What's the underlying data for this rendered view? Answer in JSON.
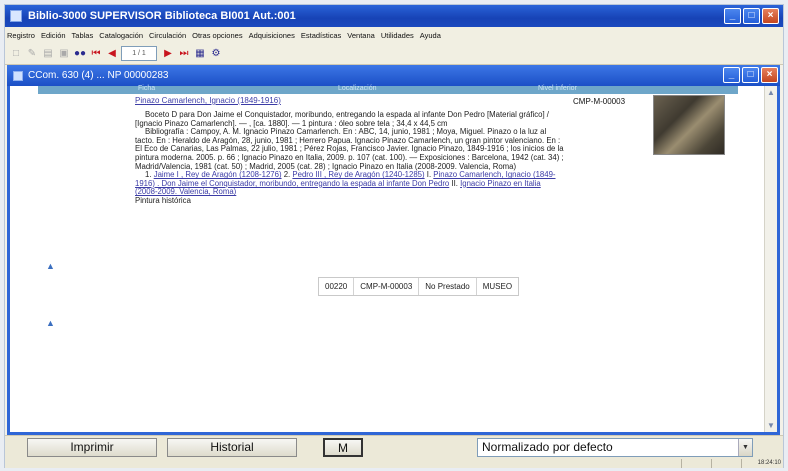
{
  "app": {
    "title": "Biblio-3000 SUPERVISOR  Biblioteca BI001 Aut.:001",
    "window_buttons": [
      "_",
      "□",
      "×"
    ]
  },
  "menu": {
    "items": [
      "Registro",
      "Edición",
      "Tablas",
      "Catalogación",
      "Circulación",
      "Otras opciones",
      "Adquisiciones",
      "Estadísticas",
      "Ventana",
      "Utilidades",
      "Ayuda"
    ]
  },
  "toolbar": {
    "record_field": "1 / 1"
  },
  "record_window": {
    "title": "CCom. 630 (4) ... NP 00000283",
    "headers": {
      "col1": "Ficha",
      "col2": "Localización",
      "col3": "Nivel inferior"
    },
    "author_link": "Pinazo Camarlench, Ignacio (1849-1916)",
    "signatura": "CMP-M-00003",
    "description": "Boceto D para Don Jaime el Conquistador, moribundo, entregando la espada al infante Don Pedro [Material gráfico] / [Ignacio Pinazo Camarlench]. — , [ca. 1880]. — 1 pintura : óleo sobre tela ; 34,4 x 44,5 cm",
    "bibliography": "Bibliografía : Campoy, A. M. Ignacio Pinazo Camarlench. En : ABC, 14, junio, 1981 ; Moya, Miguel. Pinazo o la luz al tacto. En : Heraldo de Aragón, 28, junio, 1981 ; Herrero Papua. Ignacio Pinazo Camarlench, un gran pintor valenciano. En : El Eco de Canarias, Las Palmas, 22 julio, 1981 ; Pérez Rojas, Francisco Javier. Ignacio Pinazo, 1849-1916 ; los inicios de la pintura moderna. 2005. p. 66 ; Ignacio Pinazo en Italia, 2009. p. 107 (cat. 100). — Exposiciones : Barcelona, 1942 (cat. 34) ; Madrid/Valencia, 1981 (cat. 50) ; Madrid, 2005 (cat. 28) ; Ignacio Pinazo en Italia (2008-2009. Valencia, Roma)",
    "subjects": {
      "prefix1": "1.",
      "link1": "Jaime I , Rey de Aragón (1208-1276)",
      "prefix2": "2.",
      "link2": "Pedro III , Rey de Aragón (1240-1285)",
      "prefix3": "I.",
      "link3": "Pinazo Camarlench, Ignacio (1849-1916) . Don Jaime el Conquistador, moribundo, entregando la espada al infante Don Pedro",
      "prefix4": "II.",
      "link4": "Ignacio Pinazo en Italia (2008-2009. Valencia, Roma)"
    },
    "genre": "Pintura histórica",
    "copy": [
      "00220",
      "CMP-M-00003",
      "No Prestado",
      "MUSEO"
    ]
  },
  "bottom": {
    "print_label": "Imprimir",
    "history_label": "Historial",
    "m_label": "M",
    "format_select": "Normalizado por defecto"
  },
  "status": {
    "clock": "18:24:10"
  }
}
